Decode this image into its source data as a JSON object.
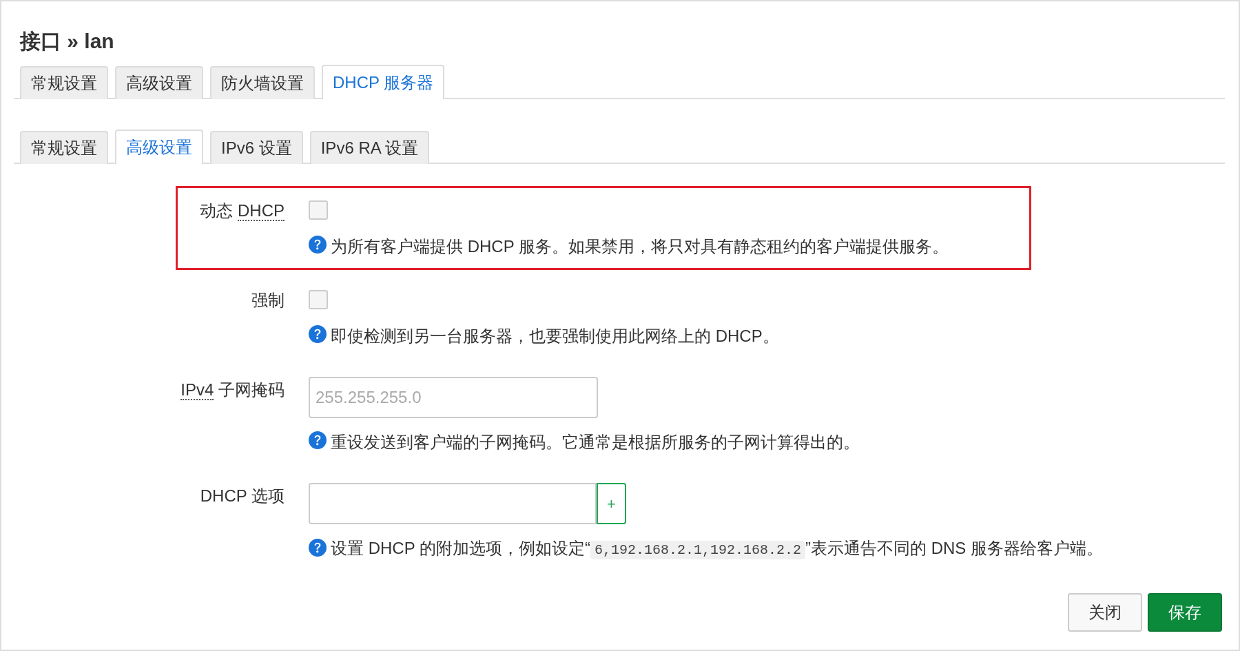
{
  "title": "接口 » lan",
  "tabs": [
    {
      "label": "常规设置",
      "selected": false
    },
    {
      "label": "高级设置",
      "selected": false
    },
    {
      "label": "防火墙设置",
      "selected": false
    },
    {
      "label": "DHCP 服务器",
      "selected": true
    }
  ],
  "subtabs": [
    {
      "label": "常规设置",
      "selected": false
    },
    {
      "label": "高级设置",
      "selected": true
    },
    {
      "label": "IPv6 设置",
      "selected": false
    },
    {
      "label": "IPv6 RA 设置",
      "selected": false
    }
  ],
  "fields": [
    {
      "kind": "checkbox",
      "highlighted": true,
      "label_parts": [
        {
          "text": "动态 ",
          "abbr": false
        },
        {
          "text": "DHCP",
          "abbr": true
        }
      ],
      "checked": false,
      "help": [
        {
          "text": "为所有客户端提供 DHCP 服务。如果禁用，将只对具有静态租约的客户端提供服务。",
          "code": false
        }
      ]
    },
    {
      "kind": "checkbox",
      "highlighted": false,
      "label_parts": [
        {
          "text": "强制",
          "abbr": false
        }
      ],
      "checked": false,
      "help": [
        {
          "text": "即使检测到另一台服务器，也要强制使用此网络上的 DHCP。",
          "code": false
        }
      ]
    },
    {
      "kind": "text",
      "highlighted": false,
      "label_parts": [
        {
          "text": "IPv4",
          "abbr": true
        },
        {
          "text": " 子网掩码",
          "abbr": false
        }
      ],
      "placeholder": "255.255.255.0",
      "help": [
        {
          "text": "重设发送到客户端的子网掩码。它通常是根据所服务的子网计算得出的。",
          "code": false
        }
      ]
    },
    {
      "kind": "dynlist",
      "highlighted": false,
      "label_parts": [
        {
          "text": "DHCP 选项",
          "abbr": false
        }
      ],
      "add_label": "+",
      "help": [
        {
          "text": "设置 DHCP 的附加选项，例如设定“",
          "code": false
        },
        {
          "text": "6,192.168.2.1,192.168.2.2",
          "code": true
        },
        {
          "text": "”表示通告不同的 DNS 服务器给客户端。",
          "code": false
        }
      ]
    }
  ],
  "buttons": [
    {
      "label": "关闭",
      "kind": "secondary"
    },
    {
      "label": "保存",
      "kind": "primary"
    }
  ]
}
